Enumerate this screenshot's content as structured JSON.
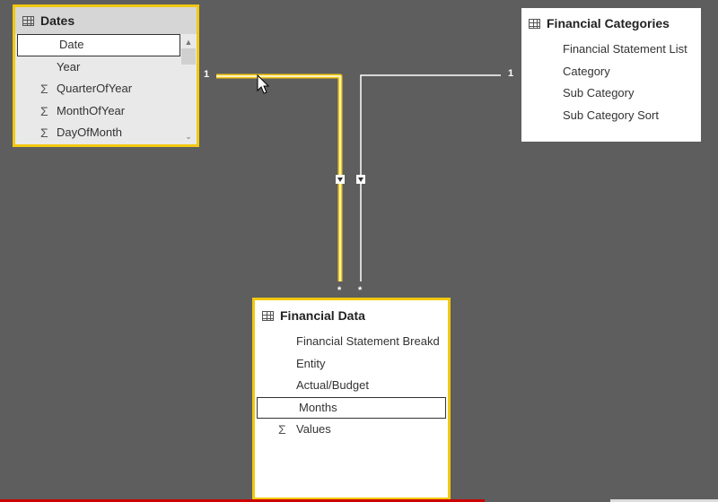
{
  "dates_table": {
    "title": "Dates",
    "fields": [
      {
        "label": "Date",
        "sigma": false
      },
      {
        "label": "Year",
        "sigma": false
      },
      {
        "label": "QuarterOfYear",
        "sigma": true
      },
      {
        "label": "MonthOfYear",
        "sigma": true
      },
      {
        "label": "DayOfMonth",
        "sigma": true
      }
    ]
  },
  "financial_categories": {
    "title": "Financial Categories",
    "fields": [
      {
        "label": "Financial Statement List"
      },
      {
        "label": "Category"
      },
      {
        "label": "Sub Category"
      },
      {
        "label": "Sub Category Sort"
      }
    ]
  },
  "financial_data": {
    "title": "Financial Data",
    "fields": [
      {
        "label": "Financial Statement Breakd",
        "sigma": false
      },
      {
        "label": "Entity",
        "sigma": false
      },
      {
        "label": "Actual/Budget",
        "sigma": false
      },
      {
        "label": "Months",
        "sigma": false
      },
      {
        "label": "Values",
        "sigma": true
      }
    ]
  },
  "relationships": {
    "dates_one": "1",
    "categories_one": "1",
    "dates_many": "*",
    "categories_many": "*"
  },
  "colors": {
    "canvas": "#5e5e5e",
    "selected_border": "#f2c811",
    "relationship_line": "#ffffff"
  },
  "icons": {
    "table": "table-icon",
    "sigma": "sigma-icon",
    "cursor": "mouse-pointer-icon"
  }
}
